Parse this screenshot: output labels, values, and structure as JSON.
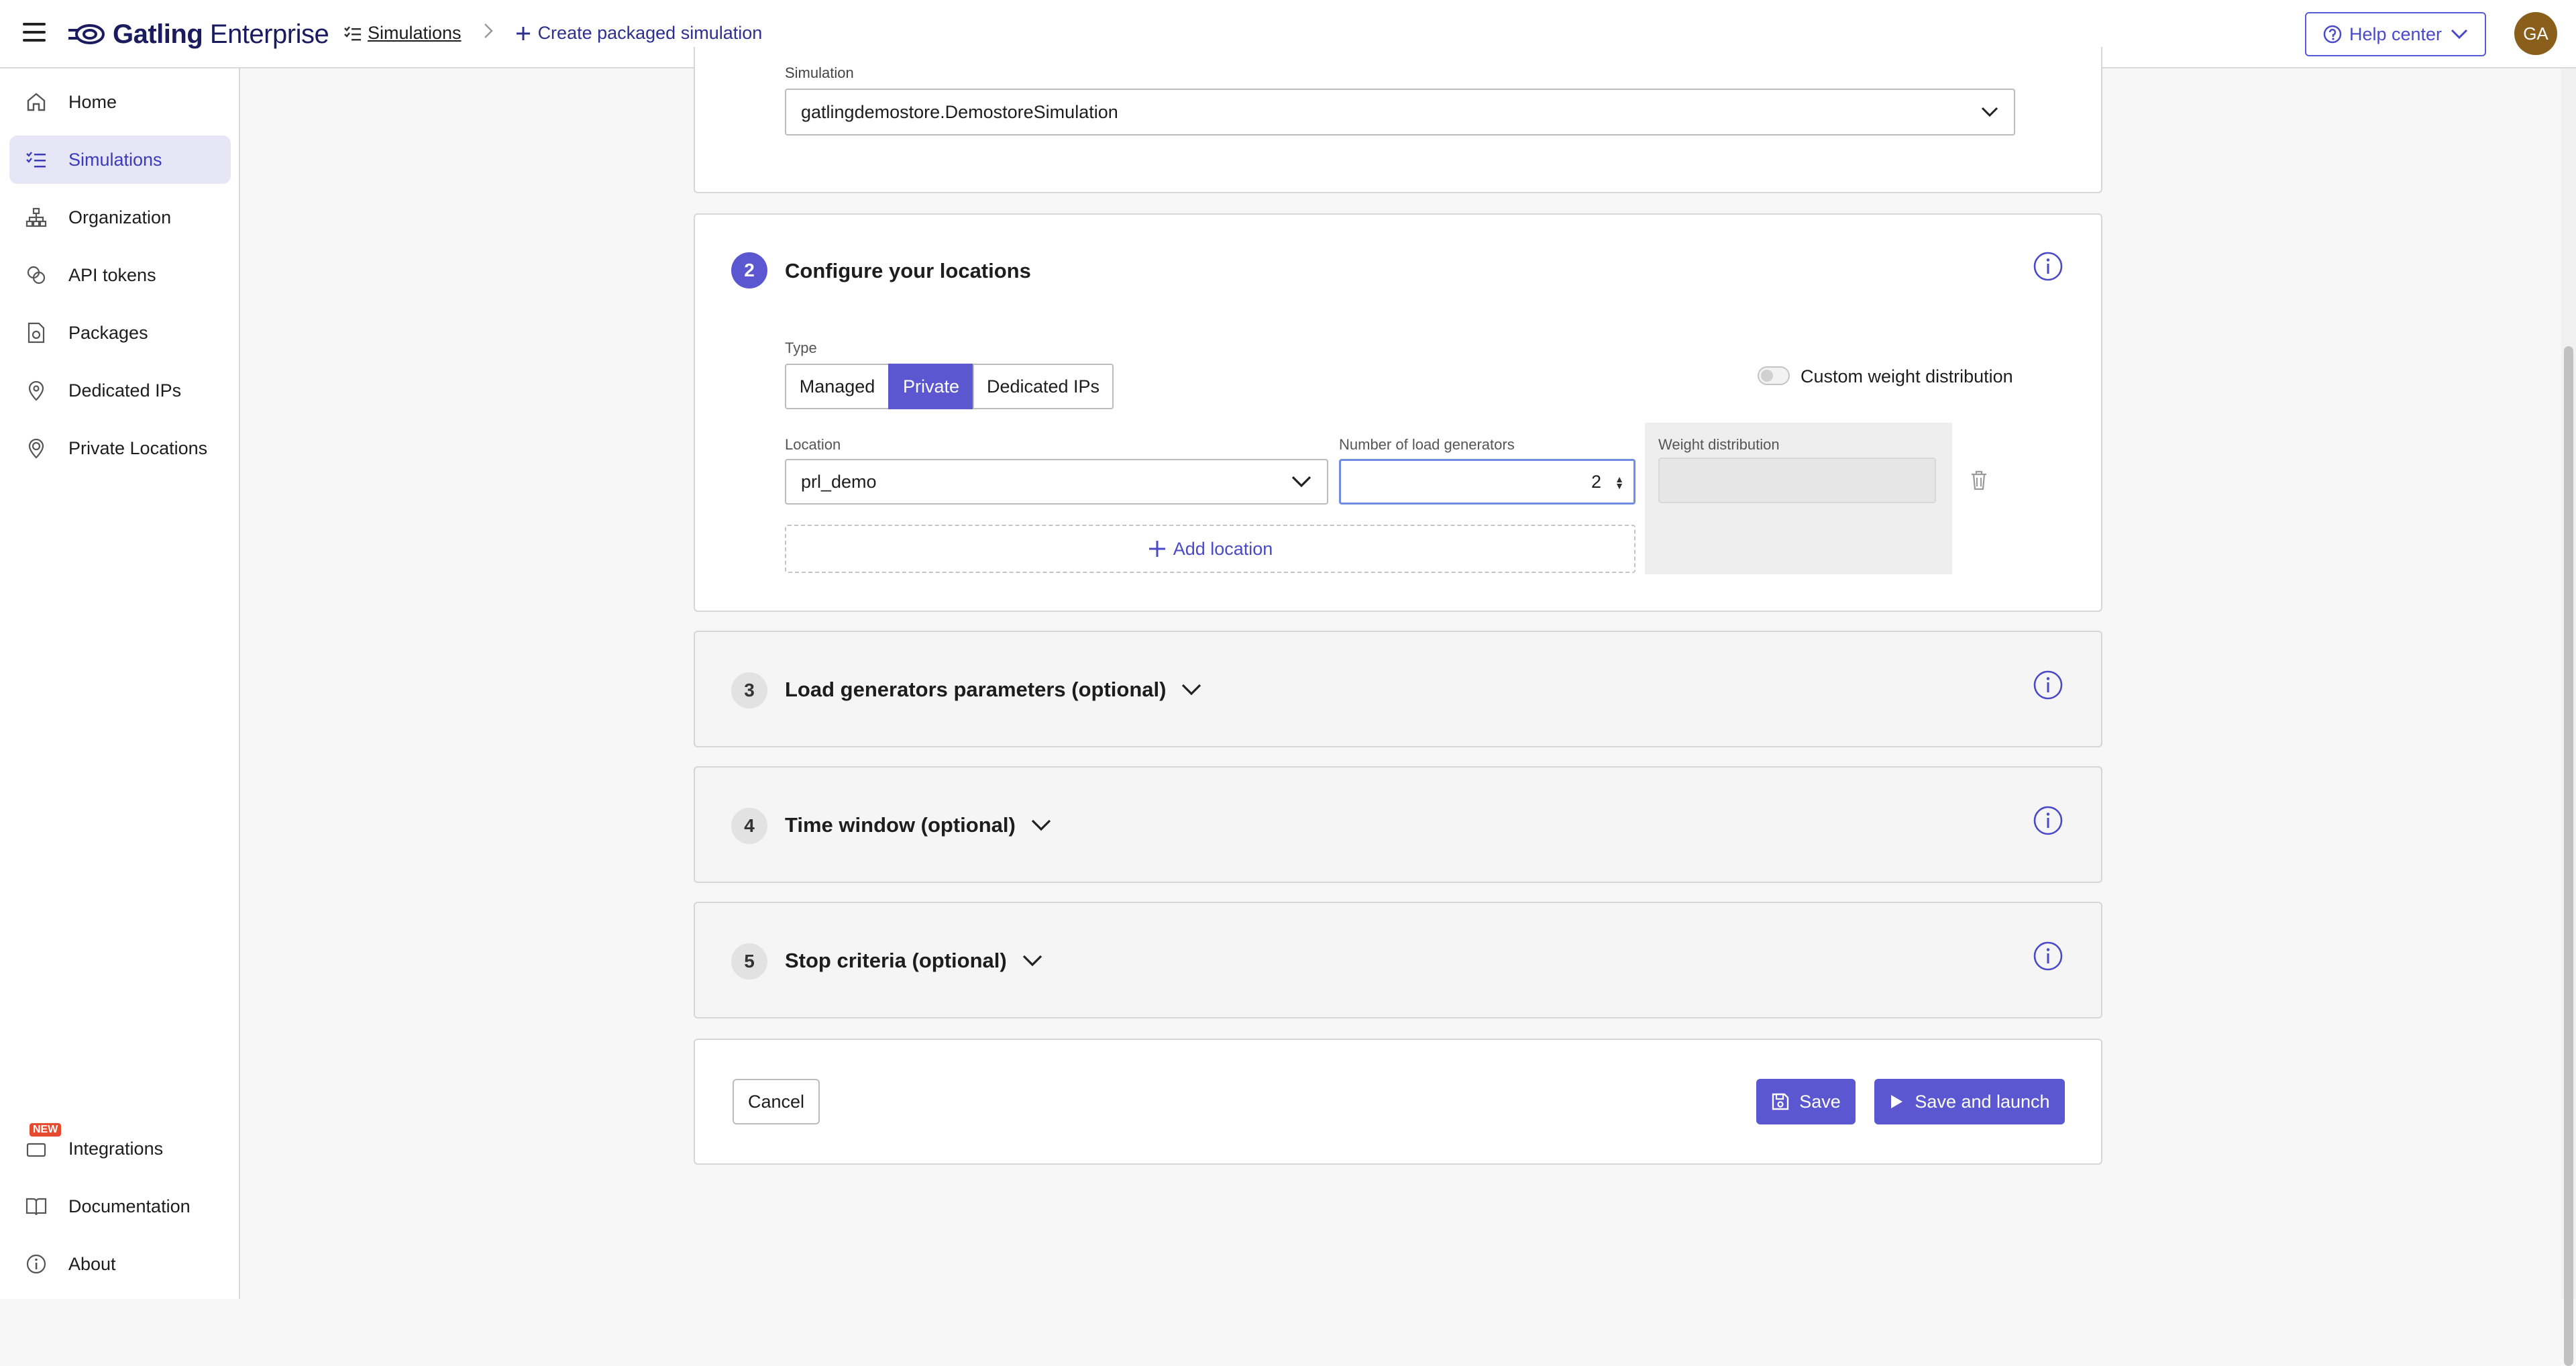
{
  "header": {
    "logo_bold": "Gatling",
    "logo_light": " Enterprise",
    "breadcrumb_simulations": "Simulations",
    "breadcrumb_separator": ">",
    "breadcrumb_create": "Create packaged simulation",
    "help_center": "Help center",
    "avatar_initials": "GA"
  },
  "sidebar": {
    "items": [
      {
        "label": "Home",
        "icon": "home-icon"
      },
      {
        "label": "Simulations",
        "icon": "list-icon"
      },
      {
        "label": "Organization",
        "icon": "org-icon"
      },
      {
        "label": "API tokens",
        "icon": "token-icon"
      },
      {
        "label": "Packages",
        "icon": "package-icon"
      },
      {
        "label": "Dedicated IPs",
        "icon": "pin-icon"
      },
      {
        "label": "Private Locations",
        "icon": "location-icon"
      }
    ],
    "bottom_items": [
      {
        "label": "Integrations",
        "icon": "integrations-icon",
        "badge": "NEW"
      },
      {
        "label": "Documentation",
        "icon": "book-icon"
      },
      {
        "label": "About",
        "icon": "info-icon"
      }
    ],
    "active": "Simulations"
  },
  "simulation_card": {
    "label": "Simulation",
    "value": "gatlingdemostore.DemostoreSimulation"
  },
  "locations_card": {
    "step": "2",
    "title": "Configure your locations",
    "type_label": "Type",
    "type_options": [
      "Managed",
      "Private",
      "Dedicated IPs"
    ],
    "type_selected": "Private",
    "custom_weight_label": "Custom weight distribution",
    "location_label": "Location",
    "location_value": "prl_demo",
    "generators_label": "Number of load generators",
    "generators_value": "2",
    "weight_label": "Weight distribution",
    "add_location": "Add location"
  },
  "collapsed_steps": [
    {
      "step": "3",
      "title": "Load generators parameters (optional)"
    },
    {
      "step": "4",
      "title": "Time window (optional)"
    },
    {
      "step": "5",
      "title": "Stop criteria (optional)"
    }
  ],
  "actions": {
    "cancel": "Cancel",
    "save": "Save",
    "save_launch": "Save and launch"
  },
  "colors": {
    "accent": "#5a57d1",
    "nav_active_bg": "#e6e6f7",
    "avatar_bg": "#8a5f1b"
  }
}
